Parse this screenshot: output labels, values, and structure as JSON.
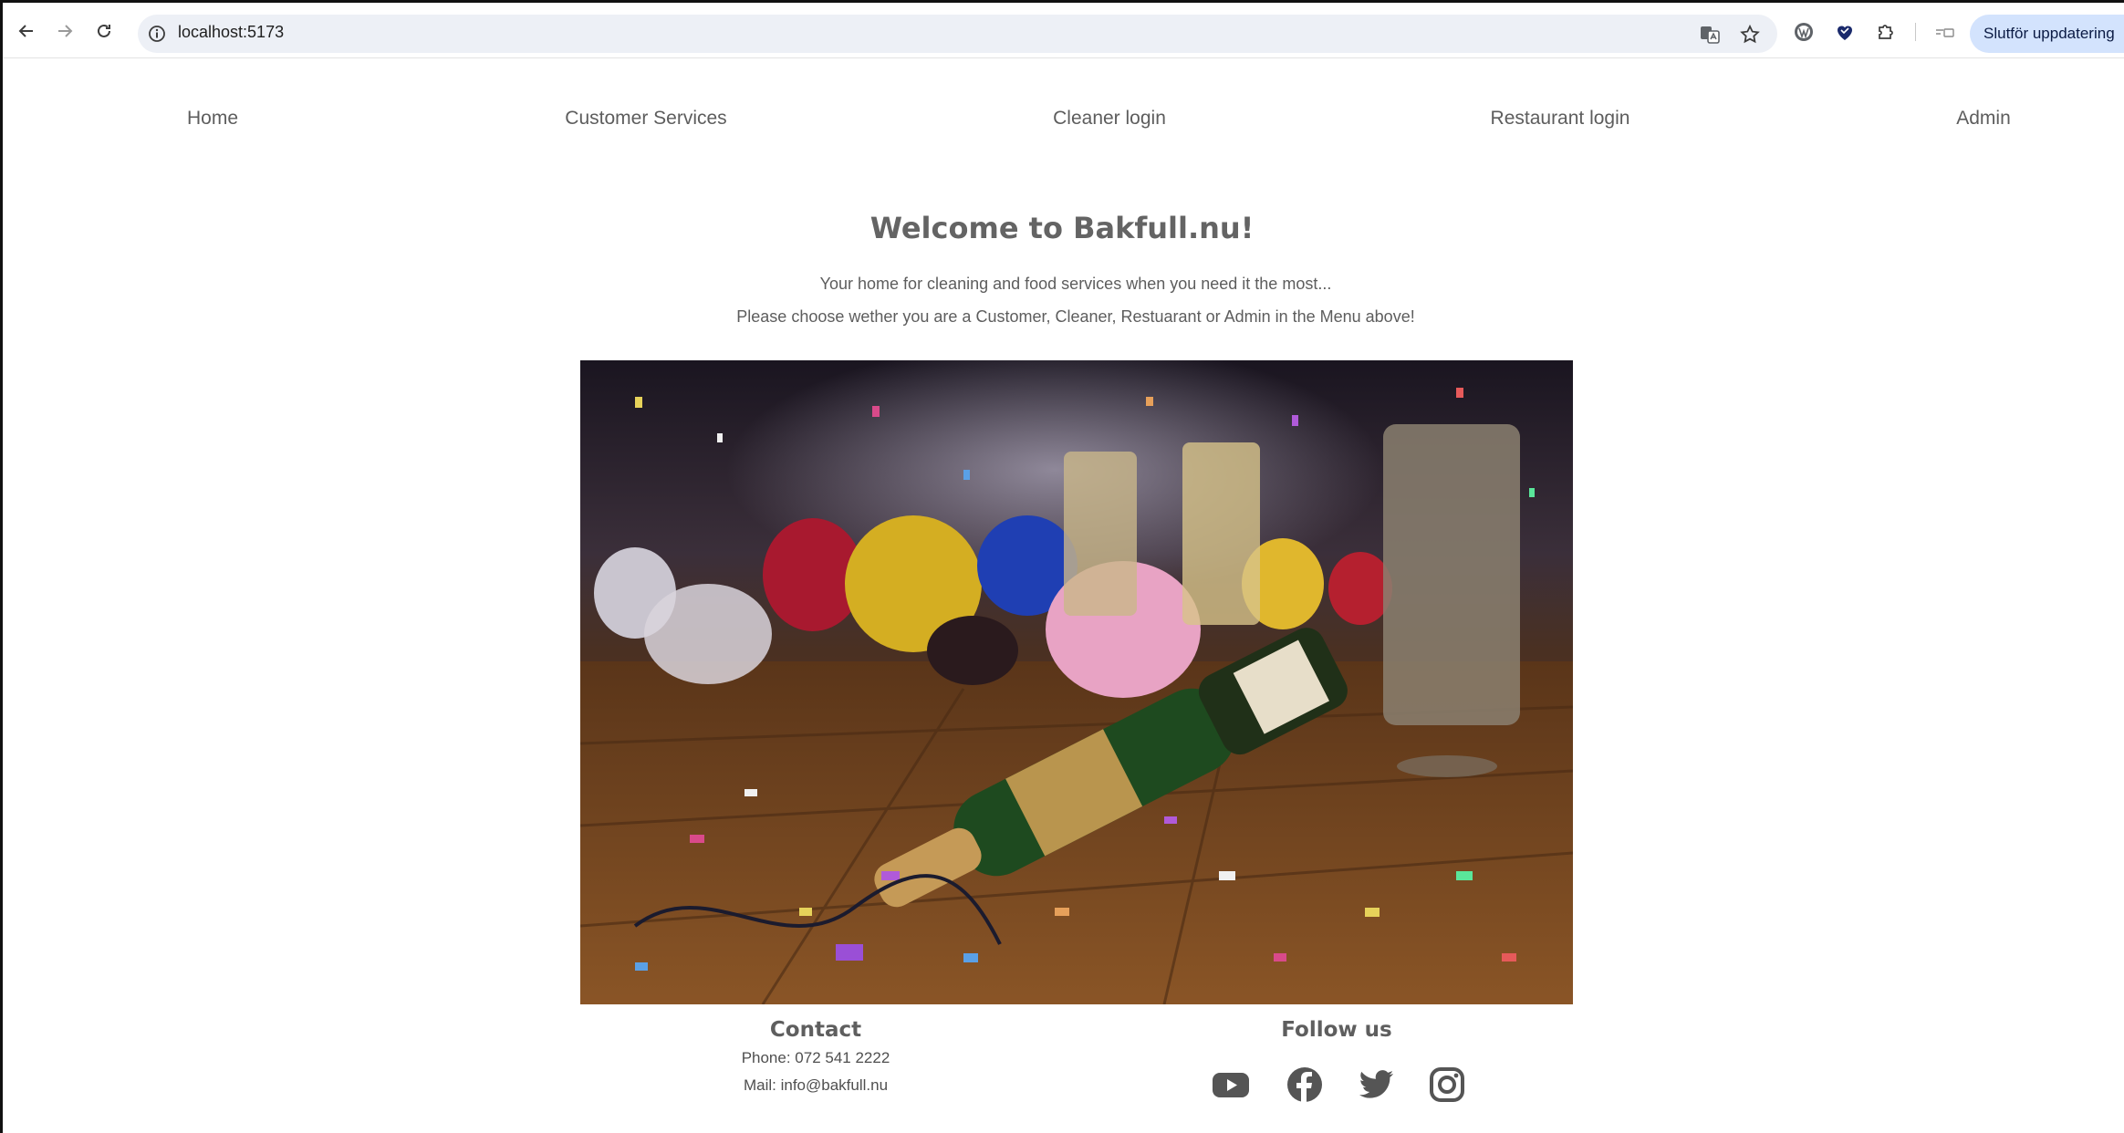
{
  "browser": {
    "url": "localhost:5173",
    "update_button_label": "Slutför uppdatering",
    "icons": [
      "back-arrow-icon",
      "forward-arrow-icon",
      "reload-icon",
      "site-info-icon",
      "translate-icon",
      "bookmark-star-icon",
      "wordpress-extension-icon",
      "heart-extension-icon",
      "extensions-puzzle-icon",
      "tab-search-icon"
    ]
  },
  "nav": {
    "items": [
      {
        "label": "Home"
      },
      {
        "label": "Customer Services"
      },
      {
        "label": "Cleaner login"
      },
      {
        "label": "Restaurant login"
      },
      {
        "label": "Admin"
      }
    ]
  },
  "hero": {
    "title": "Welcome to Bakfull.nu!",
    "line1": "Your home for cleaning and food services when you need it the most...",
    "line2": "Please choose wether you are a Customer, Cleaner, Restuarant or Admin in the Menu above!",
    "image_alt": "party-aftermath-photo"
  },
  "footer": {
    "contact": {
      "heading": "Contact",
      "phone": "Phone: 072 541 2222",
      "mail": "Mail: info@bakfull.nu"
    },
    "follow": {
      "heading": "Follow us",
      "icons": [
        "youtube-icon",
        "facebook-icon",
        "twitter-icon",
        "instagram-icon"
      ]
    }
  },
  "colors": {
    "text": "#5f5f5f",
    "omnibox_bg": "#edf0f6",
    "update_button_bg": "#d3e3fd"
  }
}
